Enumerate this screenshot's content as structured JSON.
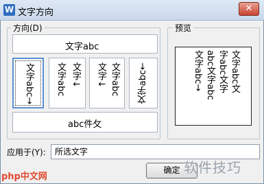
{
  "window": {
    "title": "文字方向",
    "app_icon_letter": "W",
    "close_label": "✕"
  },
  "direction_group": {
    "legend": "方向(D)",
    "options": {
      "horizontal": "文字abc",
      "vertical_rotated": "文字abc→",
      "vertical_stack": [
        "文字abc",
        "文字↓"
      ],
      "vertical_stack2": [
        "文字↓",
        "文字abc"
      ],
      "rotated_ccw": "文字abc←",
      "upside_down": "abc件攵"
    }
  },
  "preview_group": {
    "legend": "预览",
    "preview_lines": [
      "文字abc文",
      "字abc文字",
      "abc文字abc",
      "文字abc→"
    ]
  },
  "apply": {
    "label": "应用于(Y):",
    "value": "所选文字"
  },
  "buttons": {
    "ok": "确定"
  },
  "watermark": "软件技巧",
  "logo": "php中文网"
}
